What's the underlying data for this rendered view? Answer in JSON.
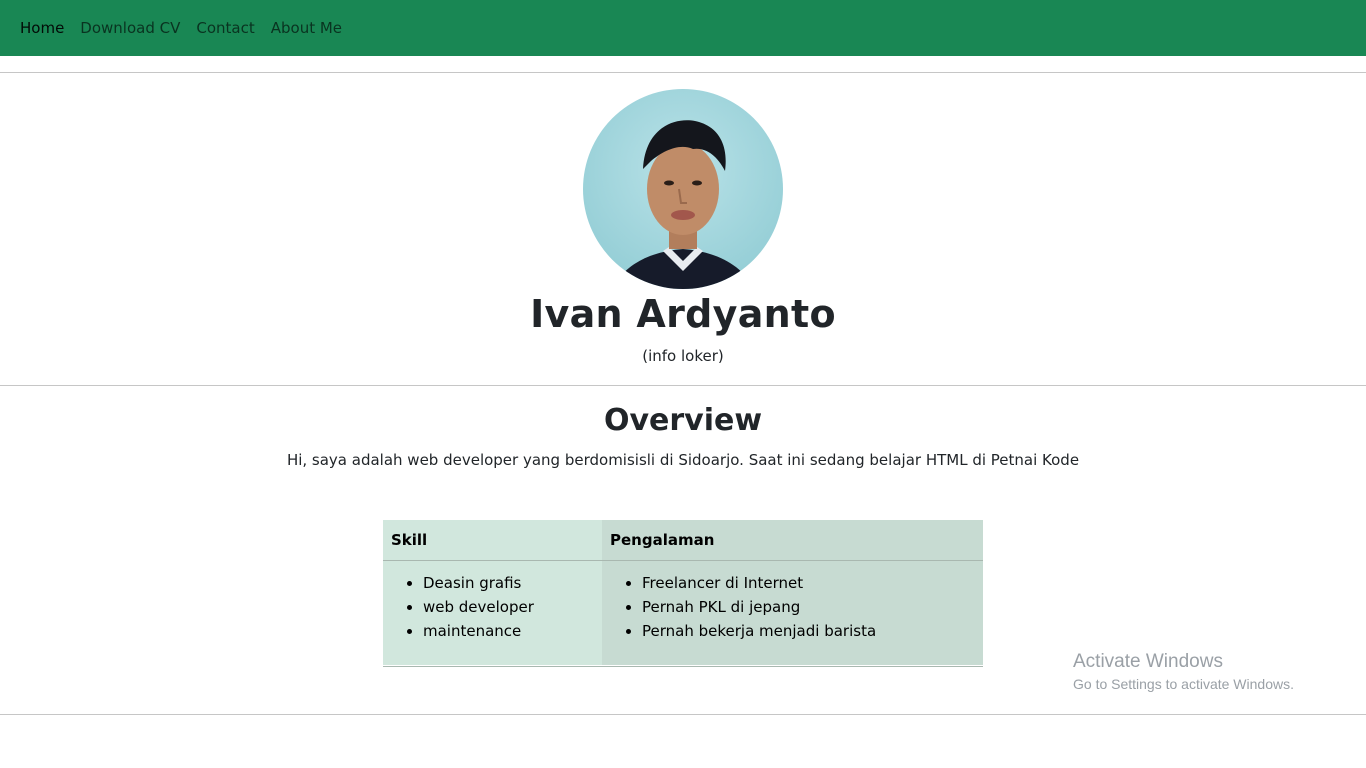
{
  "nav": {
    "items": [
      {
        "label": "Home",
        "active": true
      },
      {
        "label": "Download CV",
        "active": false
      },
      {
        "label": "Contact",
        "active": false
      },
      {
        "label": "About Me",
        "active": false
      }
    ]
  },
  "profile": {
    "name": "Ivan Ardyanto",
    "subtitle": "(info loker)"
  },
  "overview": {
    "title": "Overview",
    "text": "Hi, saya adalah web developer yang berdomisisli di Sidoarjo. Saat ini sedang belajar HTML di Petnai Kode"
  },
  "table": {
    "headers": [
      "Skill",
      "Pengalaman"
    ],
    "skills": [
      "Deasin grafis",
      "web developer",
      "maintenance"
    ],
    "experience": [
      "Freelancer di Internet",
      "Pernah PKL di jepang",
      "Pernah bekerja menjadi barista"
    ]
  },
  "watermark": {
    "title": "Activate Windows",
    "subtitle": "Go to Settings to activate Windows."
  },
  "colors": {
    "navbar": "#198754",
    "skill_column": "#d1e7dd",
    "experience_column": "#c7dbd2"
  }
}
